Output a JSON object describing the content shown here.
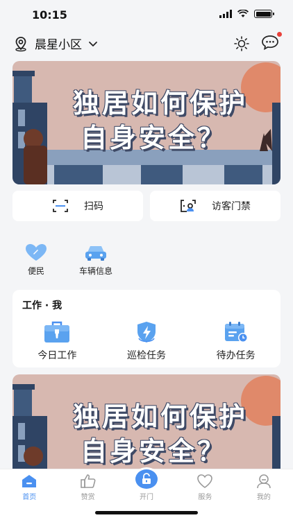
{
  "status": {
    "time": "10:15"
  },
  "header": {
    "location": "晨星小区"
  },
  "banner": {
    "line1": "独居如何保护",
    "line2": "自身安全？"
  },
  "quick": [
    {
      "label": "扫码",
      "icon": "scan-icon"
    },
    {
      "label": "访客门禁",
      "icon": "visitor-icon"
    }
  ],
  "convenience": [
    {
      "label": "便民",
      "icon": "heart-icon"
    },
    {
      "label": "车辆信息",
      "icon": "car-icon"
    }
  ],
  "work": {
    "title": "工作 · 我",
    "items": [
      {
        "label": "今日工作",
        "icon": "briefcase-icon"
      },
      {
        "label": "巡检任务",
        "icon": "shield-bolt-icon"
      },
      {
        "label": "待办任务",
        "icon": "calendar-clock-icon"
      }
    ]
  },
  "tabbar": [
    {
      "label": "首页",
      "icon": "home-icon",
      "active": true
    },
    {
      "label": "赞赏",
      "icon": "thumbs-up-icon"
    },
    {
      "label": "开门",
      "icon": "unlock-icon"
    },
    {
      "label": "服务",
      "icon": "heart-outline-icon"
    },
    {
      "label": "我的",
      "icon": "user-icon"
    }
  ],
  "colors": {
    "accent": "#4a90f0",
    "banner_bg": "#d7b8b0",
    "notification_dot": "#e8413b"
  }
}
